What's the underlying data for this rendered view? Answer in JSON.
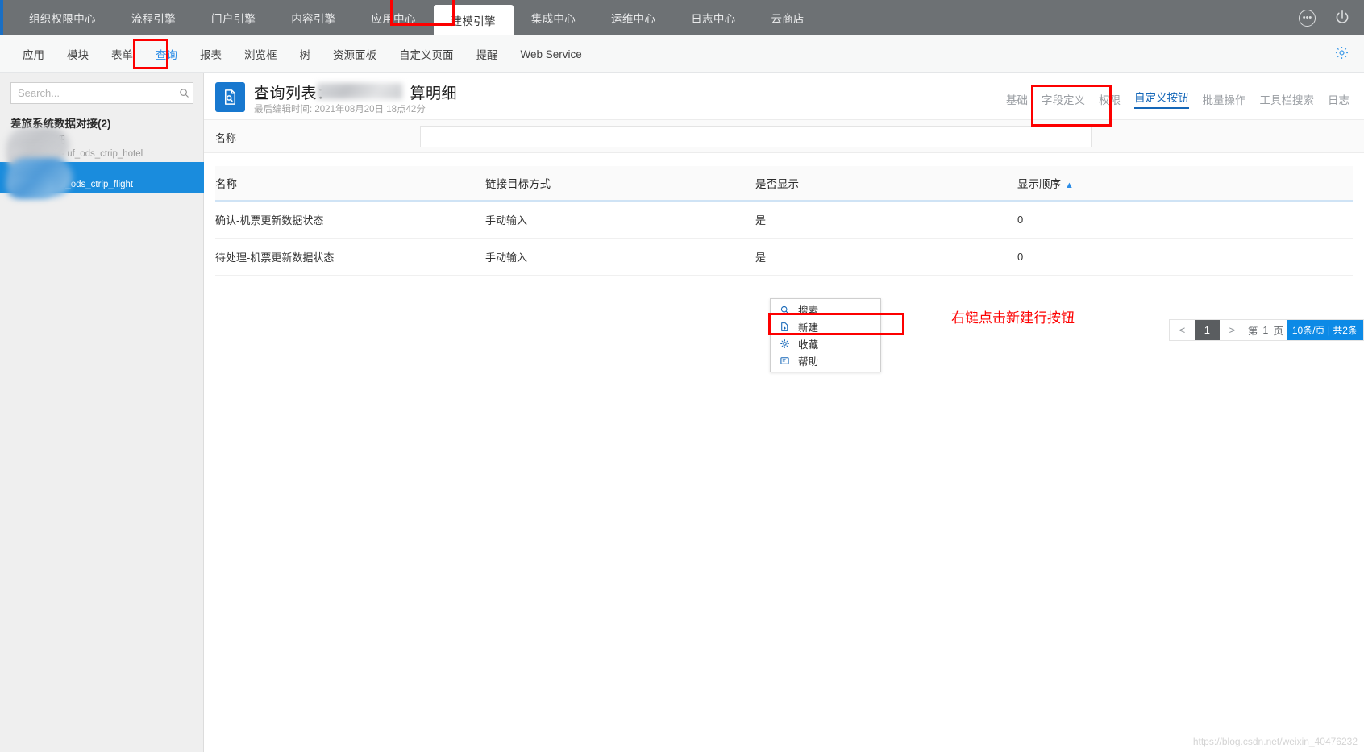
{
  "window": {
    "top_tabs": [
      {
        "label": "组织权限中心",
        "active": false
      },
      {
        "label": "流程引擎",
        "active": false
      },
      {
        "label": "门户引擎",
        "active": false
      },
      {
        "label": "内容引擎",
        "active": false
      },
      {
        "label": "应用中心",
        "active": false
      },
      {
        "label": "建模引擎",
        "active": true
      },
      {
        "label": "集成中心",
        "active": false
      },
      {
        "label": "运维中心",
        "active": false
      },
      {
        "label": "日志中心",
        "active": false
      },
      {
        "label": "云商店",
        "active": false
      }
    ],
    "more_icon": "ellipsis-icon",
    "power_icon": "power-icon"
  },
  "subnav": {
    "items": [
      {
        "label": "应用",
        "active": false
      },
      {
        "label": "模块",
        "active": false
      },
      {
        "label": "表单",
        "active": false
      },
      {
        "label": "查询",
        "active": true
      },
      {
        "label": "报表",
        "active": false
      },
      {
        "label": "浏览框",
        "active": false
      },
      {
        "label": "树",
        "active": false
      },
      {
        "label": "资源面板",
        "active": false
      },
      {
        "label": "自定义页面",
        "active": false
      },
      {
        "label": "提醒",
        "active": false
      },
      {
        "label": "Web Service",
        "active": false
      }
    ],
    "settings_icon": "gear-icon"
  },
  "sidebar": {
    "search": {
      "value": "",
      "placeholder": "Search...",
      "icon": "search-icon"
    },
    "group_title": "差旅系统数据对接(2)",
    "items": [
      {
        "title": "结算明细",
        "subtitle": "结算明细 - uf_ods_ctrip_hotel",
        "selected": false
      },
      {
        "title": "算明细",
        "subtitle": "算明细 - uf_ods_ctrip_flight",
        "selected": true
      }
    ]
  },
  "page": {
    "icon": "query-document-icon",
    "title_prefix": "查询列表：",
    "title_suffix": "算明细",
    "subtitle": "最后编辑时间: 2021年08月20日 18点42分",
    "nav": [
      {
        "label": "基础",
        "active": false
      },
      {
        "label": "字段定义",
        "active": false
      },
      {
        "label": "权限",
        "active": false
      },
      {
        "label": "自定义按钮",
        "active": true
      },
      {
        "label": "批量操作",
        "active": false
      },
      {
        "label": "工具栏搜索",
        "active": false
      },
      {
        "label": "日志",
        "active": false
      }
    ]
  },
  "filter": {
    "label": "名称",
    "input_value": "",
    "input_placeholder": ""
  },
  "table": {
    "columns": [
      "名称",
      "链接目标方式",
      "是否显示",
      "显示顺序"
    ],
    "sort_column": "显示顺序",
    "sort_arrow": "▲",
    "rows": [
      {
        "名称": "确认-机票更新数据状态",
        "链接目标方式": "手动输入",
        "是否显示": "是",
        "显示顺序": "0"
      },
      {
        "名称": "待处理-机票更新数据状态",
        "链接目标方式": "手动输入",
        "是否显示": "是",
        "显示顺序": "0"
      }
    ]
  },
  "pagination": {
    "prev": "<",
    "current_page": "1",
    "next": ">",
    "goto_prefix": "第",
    "goto_value": "1",
    "goto_suffix": "页",
    "summary": "10条/页 | 共2条"
  },
  "context_menu": {
    "items": [
      {
        "label": "搜索",
        "icon": "search-icon"
      },
      {
        "label": "新建",
        "icon": "new-document-icon",
        "highlighted": true
      },
      {
        "label": "收藏",
        "icon": "star-favorite-icon"
      },
      {
        "label": "帮助",
        "icon": "help-icon"
      }
    ]
  },
  "annotation": {
    "text": "右键点击新建行按钮",
    "color": "#fd0000"
  },
  "watermark": "https://blog.csdn.net/weixin_40476232",
  "colors": {
    "accent_blue": "#1a6fc4",
    "link_blue": "#2b8ce6",
    "topbar_gray": "#6d7174",
    "sidebar_gray": "#efefef",
    "selected_blue": "#1a8cdd",
    "pager_blue": "#0c8ae6"
  }
}
